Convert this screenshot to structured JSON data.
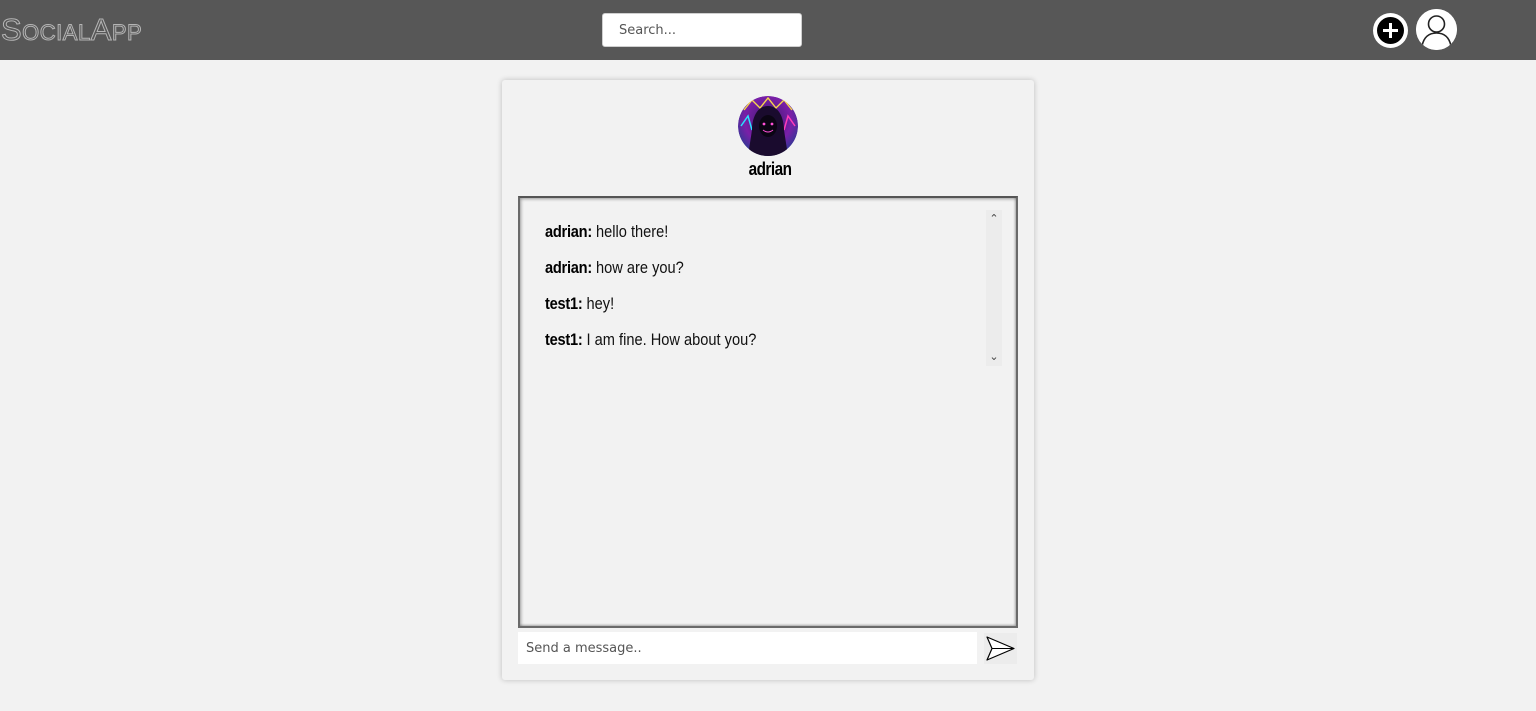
{
  "header": {
    "logo": "SocialApp",
    "search": {
      "placeholder": "Search...",
      "value": ""
    },
    "add_icon": "plus-circle-icon",
    "profile_icon": "user-avatar-icon"
  },
  "chat": {
    "username": "adrian",
    "avatar": "hooded-figure-avatar",
    "messages": [
      {
        "sender": "adrian:",
        "text": "hello there!"
      },
      {
        "sender": "adrian:",
        "text": "how are you?"
      },
      {
        "sender": "test1:",
        "text": "hey!"
      },
      {
        "sender": "test1:",
        "text": "I am fine. How about you?"
      }
    ],
    "compose": {
      "placeholder": "Send a message..",
      "value": ""
    },
    "send_icon": "send-arrow-icon"
  },
  "colors": {
    "topbar": "#575757",
    "background": "#f2f2f2"
  }
}
